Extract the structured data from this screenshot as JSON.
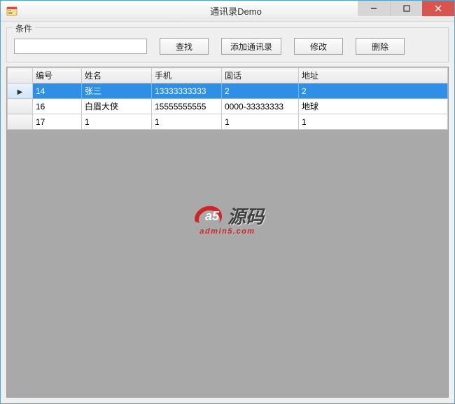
{
  "window": {
    "title": "通讯录Demo"
  },
  "groupbox": {
    "legend": "条件"
  },
  "toolbar": {
    "search_value": "",
    "search_placeholder": "",
    "find_label": "查找",
    "add_label": "添加通讯录",
    "edit_label": "修改",
    "delete_label": "删除"
  },
  "grid": {
    "columns": [
      "编号",
      "姓名",
      "手机",
      "固话",
      "地址"
    ],
    "rows": [
      {
        "selected": true,
        "cells": [
          "14",
          "张三",
          "13333333333",
          "2",
          "2"
        ]
      },
      {
        "selected": false,
        "cells": [
          "16",
          "白眉大侠",
          "15555555555",
          "0000-33333333",
          "地球"
        ]
      },
      {
        "selected": false,
        "cells": [
          "17",
          "1",
          "1",
          "1",
          "1"
        ]
      }
    ]
  },
  "watermark": {
    "badge_text": "a5",
    "main_text": "源码",
    "sub_text": "admin5.com"
  },
  "colors": {
    "accent": "#2f8fe6",
    "close_btn": "#d9534f",
    "watermark_red": "#d02020"
  }
}
